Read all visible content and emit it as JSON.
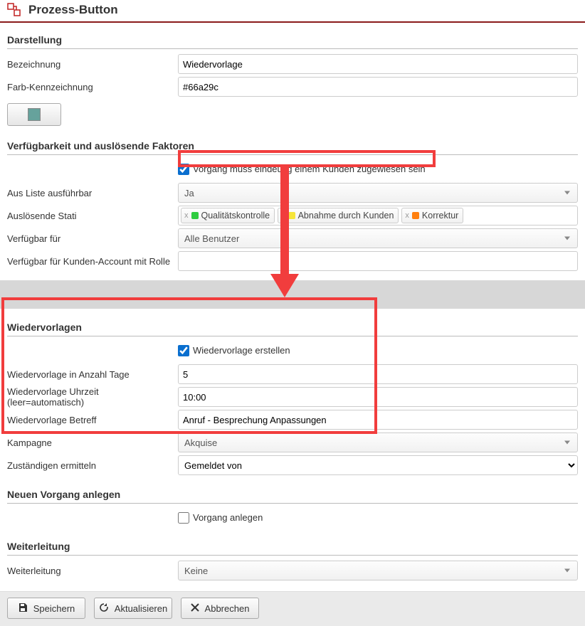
{
  "page": {
    "title": "Prozess-Button"
  },
  "sections": {
    "darstellung": {
      "title": "Darstellung",
      "bezeichnung_label": "Bezeichnung",
      "bezeichnung_value": "Wiedervorlage",
      "farb_label": "Farb-Kennzeichnung",
      "farb_value": "#66a29c"
    },
    "verfuegbarkeit": {
      "title": "Verfügbarkeit und auslösende Faktoren",
      "checkbox_label": "Vorgang muss eindeutig einem Kunden zugewiesen sein",
      "checkbox_checked": true,
      "aus_liste_label": "Aus Liste ausführbar",
      "aus_liste_value": "Ja",
      "stati_label": "Auslösende Stati",
      "stati": [
        {
          "label": "Qualitätskontrolle",
          "color": "#2ecc40"
        },
        {
          "label": "Abnahme durch Kunden",
          "color": "#f6e53a"
        },
        {
          "label": "Korrektur",
          "color": "#ff7f0e"
        }
      ],
      "verfuegbar_label": "Verfügbar für",
      "verfuegbar_value": "Alle Benutzer",
      "rolle_label": "Verfügbar für Kunden-Account mit Rolle",
      "rolle_value": ""
    },
    "wiedervorlagen": {
      "title": "Wiedervorlagen",
      "checkbox_label": "Wiedervorlage erstellen",
      "checkbox_checked": true,
      "tage_label": "Wiedervorlage in Anzahl Tage",
      "tage_value": "5",
      "uhrzeit_label": "Wiedervorlage Uhrzeit (leer=automatisch)",
      "uhrzeit_value": "10:00",
      "betreff_label": "Wiedervorlage Betreff",
      "betreff_value": "Anruf - Besprechung Anpassungen",
      "kampagne_label": "Kampagne",
      "kampagne_value": "Akquise",
      "zust_label": "Zuständigen ermitteln",
      "zust_value": "Gemeldet von"
    },
    "neu": {
      "title": "Neuen Vorgang anlegen",
      "checkbox_label": "Vorgang anlegen",
      "checkbox_checked": false
    },
    "weiterleitung": {
      "title": "Weiterleitung",
      "label": "Weiterleitung",
      "value": "Keine"
    }
  },
  "footer": {
    "save": "Speichern",
    "refresh": "Aktualisieren",
    "cancel": "Abbrechen"
  },
  "colors": {
    "accent_red": "#8a1a1a",
    "annotation": "#f13d3d"
  }
}
